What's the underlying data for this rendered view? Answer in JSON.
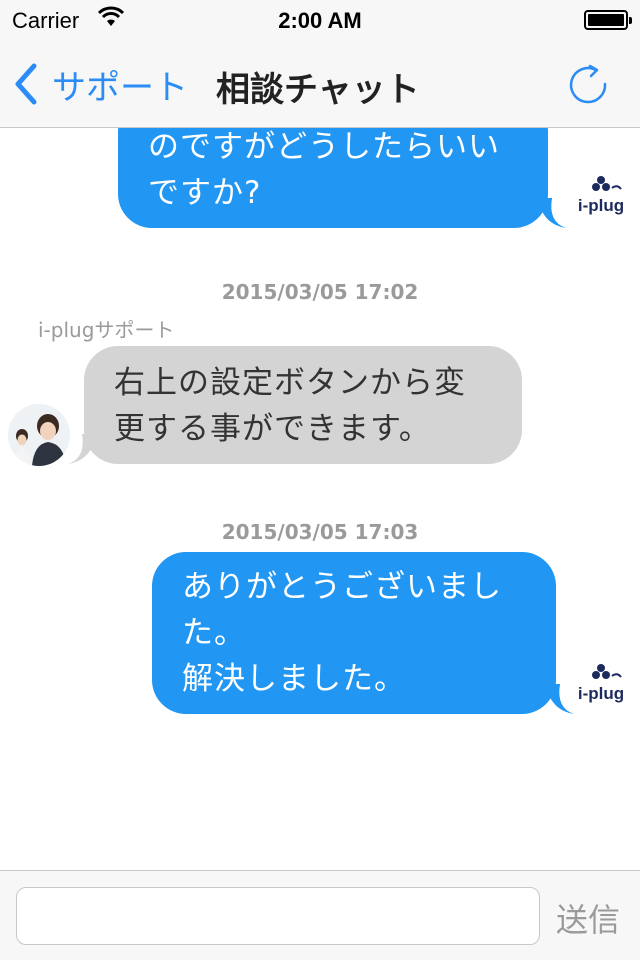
{
  "status_bar": {
    "carrier": "Carrier",
    "time": "2:00 AM"
  },
  "nav": {
    "back_label": "サポート",
    "title": "相談チャット",
    "accent_color": "#2a8cf4"
  },
  "messages": [
    {
      "direction": "outgoing",
      "lines": [
        "のですがどうしたらいい",
        "ですか?"
      ],
      "avatar_text": "i-plug"
    },
    {
      "timestamp": "2015/03/05 17:02",
      "direction": "incoming",
      "sender": "i-plugサポート",
      "lines": [
        "右上の設定ボタンから変",
        "更する事ができます。"
      ]
    },
    {
      "timestamp": "2015/03/05 17:03",
      "direction": "outgoing",
      "lines": [
        "ありがとうございまし",
        "た。",
        "解決しました。"
      ],
      "avatar_text": "i-plug"
    }
  ],
  "input": {
    "value": "",
    "placeholder": ""
  },
  "send_label": "送信",
  "colors": {
    "outgoing_bubble": "#2196f3",
    "incoming_bubble": "#d4d4d4",
    "timestamp_text": "#9a9a9a"
  }
}
